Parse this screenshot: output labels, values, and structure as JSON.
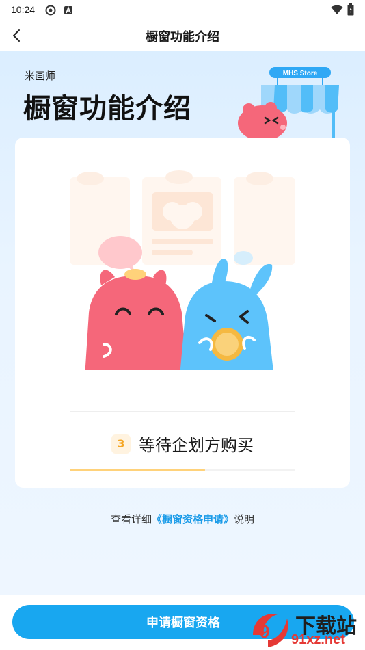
{
  "status_bar": {
    "time": "10:24"
  },
  "nav": {
    "title": "橱窗功能介绍"
  },
  "hero": {
    "subtitle": "米画师",
    "title": "橱窗功能介绍",
    "store_sign": "MHS Store"
  },
  "step": {
    "number": "3",
    "label": "等待企划方购买",
    "progress": 0.6
  },
  "detail": {
    "prefix": "查看详细",
    "link": "《橱窗资格申请》",
    "suffix": "说明"
  },
  "apply_button": {
    "label": "申请橱窗资格"
  },
  "watermark": {
    "top": "下载站",
    "bottom": "91xz.net"
  },
  "colors": {
    "accent": "#18a7f0",
    "step_number": "#f5a623",
    "progress": "#ffd27a",
    "link": "#1a9be8"
  }
}
